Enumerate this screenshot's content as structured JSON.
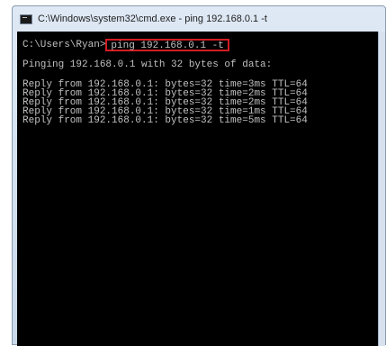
{
  "window": {
    "title": "C:\\Windows\\system32\\cmd.exe - ping  192.168.0.1 -t",
    "icon": "cmd-icon"
  },
  "console": {
    "prompt": "C:\\Users\\Ryan>",
    "command": "ping 192.168.0.1 -t",
    "pinging": "Pinging 192.168.0.1 with 32 bytes of data:",
    "replies": [
      "Reply from 192.168.0.1: bytes=32 time=3ms TTL=64",
      "Reply from 192.168.0.1: bytes=32 time=2ms TTL=64",
      "Reply from 192.168.0.1: bytes=32 time=2ms TTL=64",
      "Reply from 192.168.0.1: bytes=32 time=1ms TTL=64",
      "Reply from 192.168.0.1: bytes=32 time=5ms TTL=64"
    ]
  },
  "colors": {
    "console_bg": "#000000",
    "console_text": "#c0c0c0",
    "highlight_border": "#d21d24",
    "titlebar": "#dfe9f5"
  }
}
